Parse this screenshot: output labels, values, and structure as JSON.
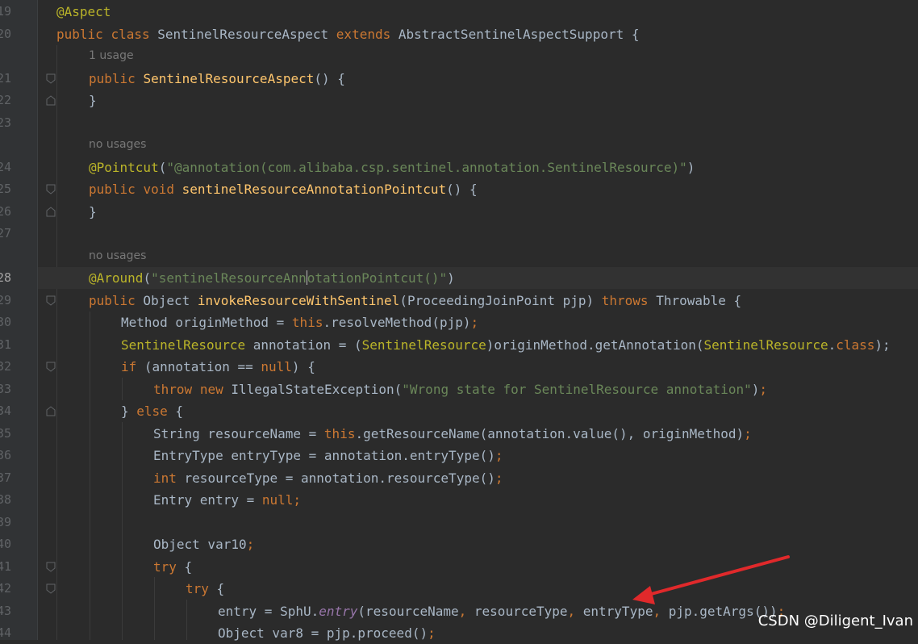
{
  "editor": {
    "watermark": "CSDN @Diligent_Ivan",
    "colors": {
      "background": "#2b2b2b",
      "keyword": "#cc7832",
      "annotation": "#bbb529",
      "string": "#6a8759",
      "method": "#ffc66d",
      "arrow": "#e0292b"
    },
    "hints": {
      "h1": "1 usage",
      "h2": "no usages",
      "h3": "no usages"
    },
    "lines": [
      {
        "n": "19",
        "t": [
          "@Aspect"
        ]
      },
      {
        "n": "20",
        "t": [
          "public",
          " ",
          "class",
          " SentinelResourceAspect ",
          "extends",
          " AbstractSentinelAspectSupport {"
        ]
      },
      {
        "n": "21",
        "t": [
          "public",
          " ",
          "SentinelResourceAspect",
          "() {"
        ]
      },
      {
        "n": "22",
        "t": [
          "}"
        ]
      },
      {
        "n": "23",
        "t": []
      },
      {
        "n": "24",
        "t": [
          "@Pointcut",
          "(",
          "\"@annotation(com.alibaba.csp.sentinel.annotation.SentinelResource)\"",
          ")"
        ]
      },
      {
        "n": "25",
        "t": [
          "public",
          " ",
          "void",
          " ",
          "sentinelResourceAnnotationPointcut",
          "() {"
        ]
      },
      {
        "n": "26",
        "t": [
          "}"
        ]
      },
      {
        "n": "27",
        "t": []
      },
      {
        "n": "28",
        "t": [
          "@Around",
          "(",
          "\"sentinelResourceAnn",
          "otationPointcut()\"",
          ")"
        ]
      },
      {
        "n": "29",
        "t": [
          "public",
          " Object ",
          "invokeResourceWithSentinel",
          "(ProceedingJoinPoint pjp) ",
          "throws",
          " Throwable {"
        ]
      },
      {
        "n": "30",
        "t": [
          "Method originMethod = ",
          "this",
          ".resolveMethod(pjp)",
          ";"
        ]
      },
      {
        "n": "31",
        "t": [
          "SentinelResource",
          " annotation = (",
          "SentinelResource",
          ")originMethod.getAnnotation(",
          "SentinelResource",
          ".",
          "class",
          ");"
        ]
      },
      {
        "n": "32",
        "t": [
          "if",
          " (annotation == ",
          "null",
          ") {"
        ]
      },
      {
        "n": "33",
        "t": [
          "throw",
          " ",
          "new",
          " IllegalStateException(",
          "\"Wrong state for SentinelResource annotation\"",
          ")",
          ";"
        ]
      },
      {
        "n": "34",
        "t": [
          "} ",
          "else",
          " {"
        ]
      },
      {
        "n": "35",
        "t": [
          "String resourceName = ",
          "this",
          ".getResourceName(annotation.value(), originMethod)",
          ";"
        ]
      },
      {
        "n": "36",
        "t": [
          "EntryType entryType = annotation.entryType()",
          ";"
        ]
      },
      {
        "n": "37",
        "t": [
          "int",
          " resourceType = annotation.resourceType()",
          ";"
        ]
      },
      {
        "n": "38",
        "t": [
          "Entry entry = ",
          "null",
          ";"
        ]
      },
      {
        "n": "39",
        "t": []
      },
      {
        "n": "40",
        "t": [
          "Object var10",
          ";"
        ]
      },
      {
        "n": "41",
        "t": [
          "try",
          " {"
        ]
      },
      {
        "n": "42",
        "t": [
          "try",
          " {"
        ]
      },
      {
        "n": "43",
        "t": [
          "entry = SphU.",
          "entry",
          "(resourceName",
          ", ",
          "resourceType",
          ", ",
          "entryType",
          ", ",
          "pjp.getArgs())",
          ";"
        ]
      },
      {
        "n": "44",
        "t": [
          "Object var8 = pjp.proceed()",
          ";"
        ]
      }
    ]
  }
}
